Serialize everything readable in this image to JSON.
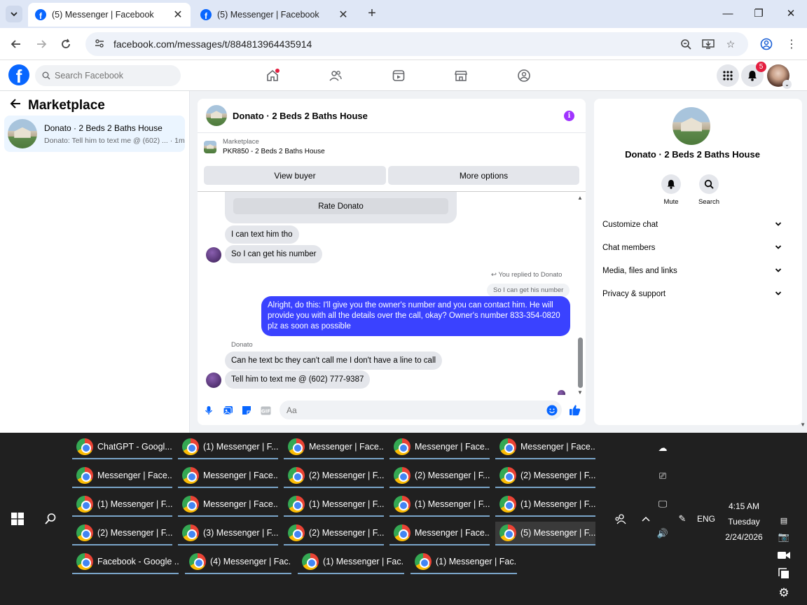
{
  "browser": {
    "tabs": [
      {
        "title": "(5) Messenger | Facebook",
        "active": true
      },
      {
        "title": "(5) Messenger | Facebook",
        "active": false
      }
    ],
    "url": "facebook.com/messages/t/884813964435914"
  },
  "fb": {
    "search_placeholder": "Search Facebook",
    "notifications_count": "5"
  },
  "left": {
    "title": "Marketplace",
    "conversation": {
      "name": "Donato · 2 Beds 2 Baths House",
      "preview": "Donato: Tell him to text me @ (602) ...",
      "time": "· 1m"
    }
  },
  "chat": {
    "title": "Donato · 2 Beds 2 Baths House",
    "marketplace_label": "Marketplace",
    "listing_id": "PKR850 - 2 Beds 2 Baths House",
    "view_buyer": "View buyer",
    "more_options": "More options",
    "rate_label": "Rate Donato",
    "messages": {
      "m1": "I can text him tho",
      "m2": "So I can get his number",
      "reply_note": "You replied to Donato",
      "quoted": "So I can get his number",
      "sent": "Alright, do this: I'll give you the owner's number and you can contact him. He will provide you with all the details over the call, okay? Owner's number 833-354-0820 plz as soon as possible",
      "sender_name": "Donato",
      "m3": "Can he text bc they can't call me I don't have a line to call",
      "m4": "Tell him to text me @ (602) 777-9387"
    },
    "composer_placeholder": "Aa"
  },
  "right": {
    "name": "Donato · 2 Beds 2 Baths House",
    "mute": "Mute",
    "search": "Search",
    "sections": [
      "Customize chat",
      "Chat members",
      "Media, files and links",
      "Privacy & support"
    ]
  },
  "taskbar": {
    "rows": [
      [
        "ChatGPT - Googl...",
        "(1) Messenger | F...",
        "Messenger | Face...",
        "Messenger | Face...",
        "Messenger | Face..."
      ],
      [
        "Messenger | Face...",
        "Messenger | Face...",
        "(2) Messenger | F...",
        "(2) Messenger | F...",
        "(2) Messenger | F..."
      ],
      [
        "(1) Messenger | F...",
        "Messenger | Face...",
        "(1) Messenger | F...",
        "(1) Messenger | F...",
        "(1) Messenger | F..."
      ],
      [
        "(2) Messenger | F...",
        "(3) Messenger | F...",
        "(2) Messenger | F...",
        "Messenger | Face...",
        "(5) Messenger | F..."
      ]
    ],
    "last_row": [
      "Facebook - Google ...",
      "(4) Messenger | Fac...",
      "(1) Messenger | Fac...",
      "(1) Messenger | Fac..."
    ],
    "language": "ENG",
    "time": "4:15 AM",
    "day": "Tuesday",
    "date": "2/24/2026"
  }
}
